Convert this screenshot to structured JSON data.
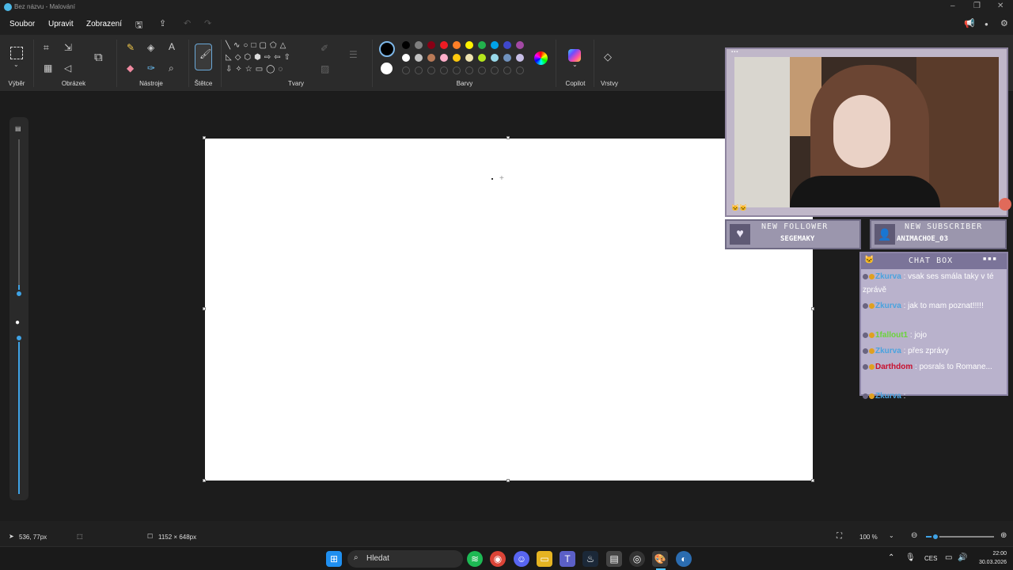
{
  "window": {
    "title": "Bez názvu - Malování"
  },
  "menu": {
    "file": "Soubor",
    "edit": "Upravit",
    "view": "Zobrazení"
  },
  "ribbon": {
    "groups": {
      "selection": "Výběr",
      "image": "Obrázek",
      "tools": "Nástroje",
      "brushes": "Štětce",
      "shapes": "Tvary",
      "colors": "Barvy",
      "copilot": "Copilot",
      "layers": "Vrstvy"
    },
    "palette_row1": [
      "#000000",
      "#7f7f7f",
      "#880015",
      "#ed1c24",
      "#ff7f27",
      "#fff200",
      "#22b14c",
      "#00a2e8",
      "#3f48cc",
      "#a349a4"
    ],
    "palette_row2": [
      "#ffffff",
      "#c3c3c3",
      "#b97a57",
      "#ffaec9",
      "#ffc90e",
      "#efe4b0",
      "#b5e61d",
      "#99d9ea",
      "#7092be",
      "#c8bfe7"
    ],
    "primary_color": "#000000",
    "secondary_color": "#ffffff"
  },
  "status": {
    "cursor_pos": "536, 77px",
    "canvas_size": "1152 × 648px",
    "zoom": "100 %"
  },
  "taskbar": {
    "search_placeholder": "Hledat",
    "lang": "CES",
    "time": "22:00",
    "date": "30.03.2026"
  },
  "overlay": {
    "new_follower_title": "NEW FOLLOWER",
    "new_follower_name": "SEGEMAKY",
    "new_sub_title": "NEW SUBSCRIBER",
    "new_sub_name": "ANIMACHOE_03",
    "chat_title": "CHAT BOX",
    "messages": [
      {
        "user": "Zkurva",
        "text": ": vsak ses smála taky v té zprávě",
        "color": "#4aa3df"
      },
      {
        "user": "Zkurva",
        "text": ": jak to mam poznat!!!!!",
        "color": "#4aa3df"
      },
      {
        "user": "1fallout1",
        "text": ": jojo",
        "color": "#6bd43a"
      },
      {
        "user": "Zkurva",
        "text": ": přes zprávy",
        "color": "#4aa3df"
      },
      {
        "user": "Darthdom",
        "text": ": posrals to Romane...",
        "color": "#c8102e"
      },
      {
        "user": "Zkurva",
        "text": ":",
        "color": "#4aa3df"
      }
    ]
  }
}
